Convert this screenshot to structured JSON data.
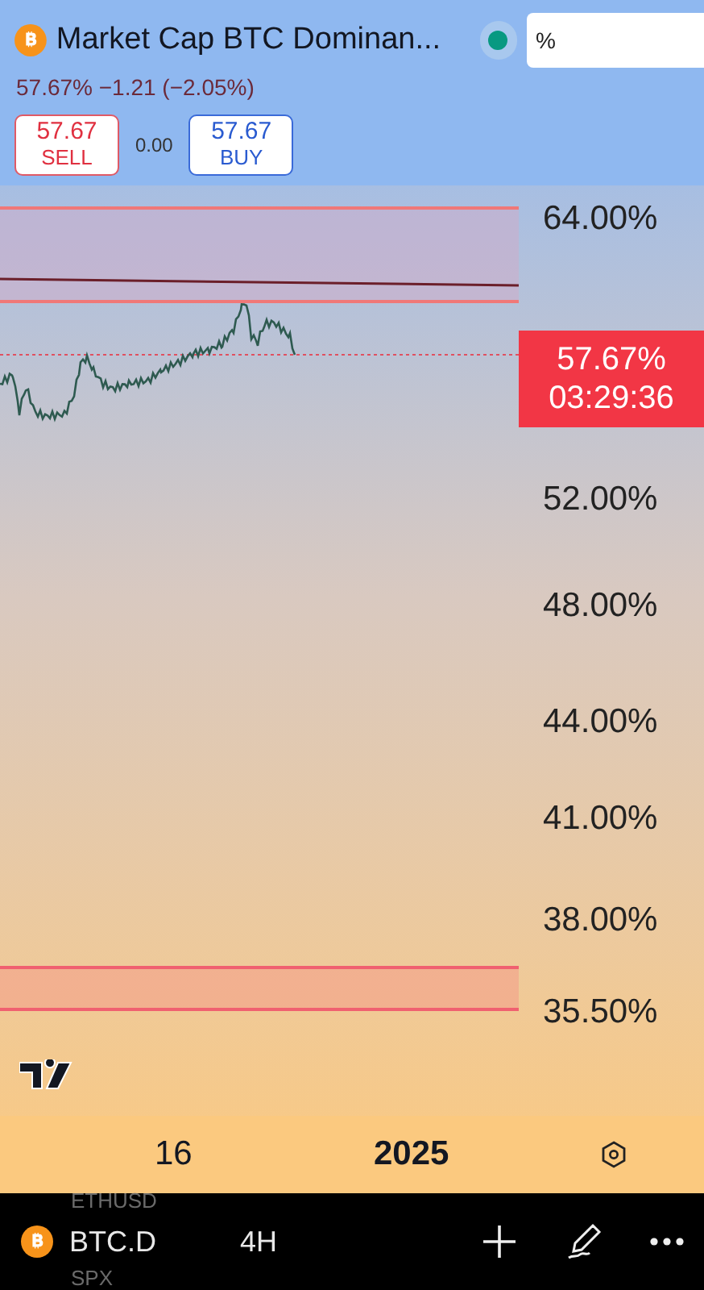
{
  "header": {
    "title": "Market Cap BTC Dominan...",
    "quote": "57.67%  −1.21 (−2.05%)",
    "sell": {
      "price": "57.67",
      "label": "SELL"
    },
    "spread": "0.00",
    "buy": {
      "price": "57.67",
      "label": "BUY"
    },
    "market_open": true,
    "unit_field": {
      "value": "%"
    }
  },
  "price_axis": [
    {
      "label": "64.00%"
    },
    {
      "label": "52.00%"
    },
    {
      "label": "48.00%"
    },
    {
      "label": "44.00%"
    },
    {
      "label": "41.00%"
    },
    {
      "label": "38.00%"
    },
    {
      "label": "35.50%"
    }
  ],
  "last_price": {
    "price": "57.67%",
    "countdown": "03:29:36"
  },
  "time_axis": [
    {
      "label": "16",
      "kind": "day"
    },
    {
      "label": "2025",
      "kind": "year"
    }
  ],
  "bottom_bar": {
    "symbol": "BTC.D",
    "interval": "4H",
    "picker_above": "ETHUSD",
    "picker_below": "SPX"
  }
}
